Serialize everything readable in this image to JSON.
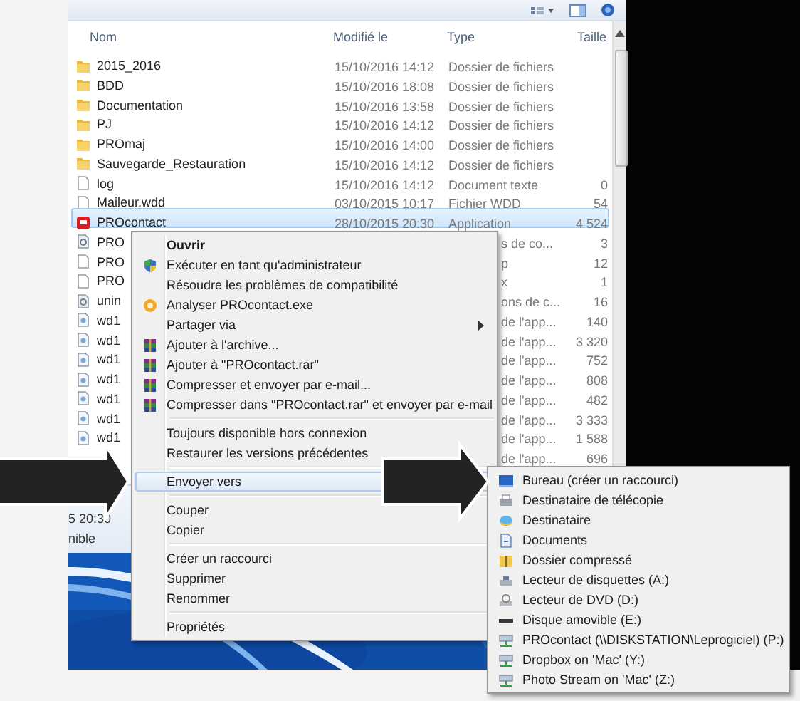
{
  "columns": [
    {
      "label": "Nom"
    },
    {
      "label": "Modifié le"
    },
    {
      "label": "Type"
    },
    {
      "label": "Taille"
    }
  ],
  "files": [
    {
      "name": "2015_2016",
      "modified": "15/10/2016 14:12",
      "type": "Dossier de fichiers",
      "kind": "folder",
      "selected": false
    },
    {
      "name": "BDD",
      "modified": "15/10/2016 18:08",
      "type": "Dossier de fichiers",
      "kind": "folder",
      "selected": false
    },
    {
      "name": "Documentation",
      "modified": "15/10/2016 13:58",
      "type": "Dossier de fichiers",
      "kind": "folder",
      "selected": false
    },
    {
      "name": "PJ",
      "modified": "15/10/2016 14:12",
      "type": "Dossier de fichiers",
      "kind": "folder",
      "selected": false
    },
    {
      "name": "PROmaj",
      "modified": "15/10/2016 14:00",
      "type": "Dossier de fichiers",
      "kind": "folder",
      "selected": false
    },
    {
      "name": "Sauvegarde_Restauration",
      "modified": "15/10/2016 14:12",
      "type": "Dossier de fichiers",
      "kind": "folder",
      "selected": false
    },
    {
      "name": "log",
      "modified": "15/10/2016 14:12",
      "type": "Document texte",
      "size": "0",
      "kind": "document",
      "selected": false
    },
    {
      "name": "Maileur.wdd",
      "modified": "03/10/2015 10:17",
      "type": "Fichier WDD",
      "size": "54",
      "kind": "document",
      "selected": false
    },
    {
      "name": "PROcontact",
      "modified": "28/10/2015 20:30",
      "type": "Application",
      "size": "4 524",
      "kind": "app",
      "selected": true
    },
    {
      "name": "PRO",
      "type": "s de co...",
      "size": "3",
      "kind": "config",
      "selected": false
    },
    {
      "name": "PRO",
      "type": "p",
      "size": "12",
      "kind": "document",
      "selected": false
    },
    {
      "name": "PRO",
      "type": "x",
      "size": "1",
      "kind": "document",
      "selected": false
    },
    {
      "name": "unin",
      "type": "ons de c...",
      "size": "16",
      "kind": "config",
      "selected": false
    },
    {
      "name": "wd1",
      "type": "de l'app...",
      "size": "140",
      "kind": "library",
      "selected": false
    },
    {
      "name": "wd1",
      "type": "de l'app...",
      "size": "3 320",
      "kind": "library",
      "selected": false
    },
    {
      "name": "wd1",
      "type": "de l'app...",
      "size": "752",
      "kind": "library",
      "selected": false
    },
    {
      "name": "wd1",
      "type": "de l'app...",
      "size": "808",
      "kind": "library",
      "selected": false
    },
    {
      "name": "wd1",
      "type": "de l'app...",
      "size": "482",
      "kind": "library",
      "selected": false
    },
    {
      "name": "wd1",
      "type": "de l'app...",
      "size": "3 333",
      "kind": "library",
      "selected": false
    },
    {
      "name": "wd1",
      "type": "de l'app...",
      "size": "1 588",
      "kind": "library",
      "selected": false
    },
    {
      "type": "de l'app...",
      "size": "696",
      "selected": false
    }
  ],
  "details": [
    "5 20:30",
    "nible"
  ],
  "context_menu": {
    "groups": [
      [
        {
          "label": "Ouvrir",
          "kind": "plain",
          "default": true,
          "submenu": false,
          "selected": false
        },
        {
          "label": "Exécuter en tant qu'administrateur",
          "kind": "shield",
          "default": false,
          "submenu": false,
          "selected": false
        },
        {
          "label": "Résoudre les problèmes de compatibilité",
          "kind": "plain",
          "default": false,
          "submenu": false,
          "selected": false
        },
        {
          "label": "Analyser PROcontact.exe",
          "kind": "scan",
          "default": false,
          "submenu": false,
          "selected": false
        },
        {
          "label": "Partager via",
          "kind": "plain",
          "default": false,
          "submenu": true,
          "selected": false
        },
        {
          "label": "Ajouter à l'archive...",
          "kind": "archive",
          "default": false,
          "submenu": false,
          "selected": false
        },
        {
          "label": "Ajouter à \"PROcontact.rar\"",
          "kind": "archive",
          "default": false,
          "submenu": false,
          "selected": false
        },
        {
          "label": "Compresser et envoyer par e-mail...",
          "kind": "archive",
          "default": false,
          "submenu": false,
          "selected": false
        },
        {
          "label": "Compresser dans \"PROcontact.rar\" et envoyer par e-mail",
          "kind": "archive",
          "default": false,
          "submenu": false,
          "selected": false
        }
      ],
      [
        {
          "label": "Toujours disponible hors connexion",
          "kind": "plain",
          "default": false,
          "selected": false
        },
        {
          "label": "Restaurer les versions précédentes",
          "kind": "plain",
          "default": false,
          "selected": false
        }
      ],
      [
        {
          "label": "Envoyer vers",
          "kind": "plain",
          "default": false,
          "selected": true
        }
      ],
      [
        {
          "label": "Couper",
          "kind": "plain",
          "default": false,
          "selected": false
        },
        {
          "label": "Copier",
          "kind": "plain",
          "default": false,
          "selected": false
        }
      ],
      [
        {
          "label": "Créer un raccourci",
          "kind": "plain",
          "default": false,
          "selected": false
        },
        {
          "label": "Supprimer",
          "kind": "plain",
          "default": false,
          "selected": false
        },
        {
          "label": "Renommer",
          "kind": "plain",
          "default": false,
          "selected": false
        }
      ],
      [
        {
          "label": "Propriétés",
          "kind": "plain",
          "default": false,
          "selected": false
        }
      ]
    ]
  },
  "send_to_menu": {
    "items": [
      {
        "label": "Bureau (créer un raccourci)",
        "kind": "desktop"
      },
      {
        "label": "Destinataire de télécopie",
        "kind": "fax"
      },
      {
        "label": "Destinataire",
        "kind": "mail"
      },
      {
        "label": "Documents",
        "kind": "documents"
      },
      {
        "label": "Dossier compressé",
        "kind": "zip"
      },
      {
        "label": "Lecteur de disquettes (A:)",
        "kind": "floppy"
      },
      {
        "label": "Lecteur de DVD (D:)",
        "kind": "dvd"
      },
      {
        "label": "Disque amovible (E:)",
        "kind": "removable"
      },
      {
        "label": "PROcontact (\\\\DISKSTATION\\Leprogiciel) (P:)",
        "kind": "network"
      },
      {
        "label": "Dropbox on 'Mac' (Y:)",
        "kind": "network"
      },
      {
        "label": "Photo Stream on 'Mac' (Z:)",
        "kind": "network"
      }
    ]
  }
}
